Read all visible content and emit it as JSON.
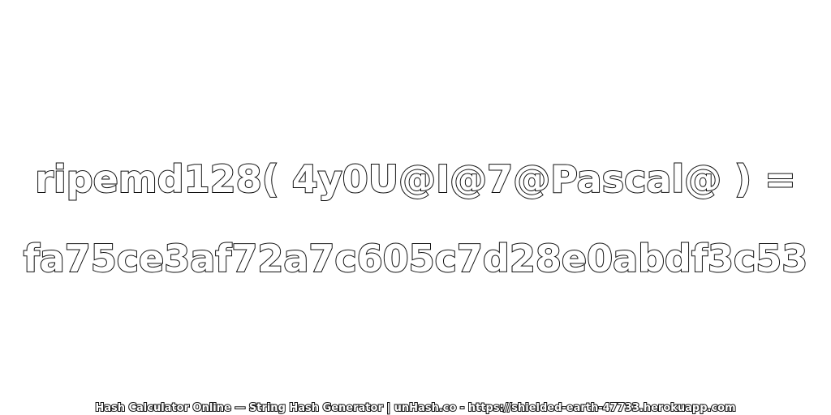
{
  "hash_expression": "ripemd128( 4y0U@I@7@Pascal@ ) =",
  "hash_digest": "fa75ce3af72a7c605c7d28e0abdf3c53",
  "footer_text": "Hash Calculator Online — String Hash Generator | unHash.co - https://shielded-earth-47733.herokuapp.com",
  "colors": {
    "background": "#ffffff",
    "text_fill": "#ffffff",
    "text_outline": "#111111"
  }
}
